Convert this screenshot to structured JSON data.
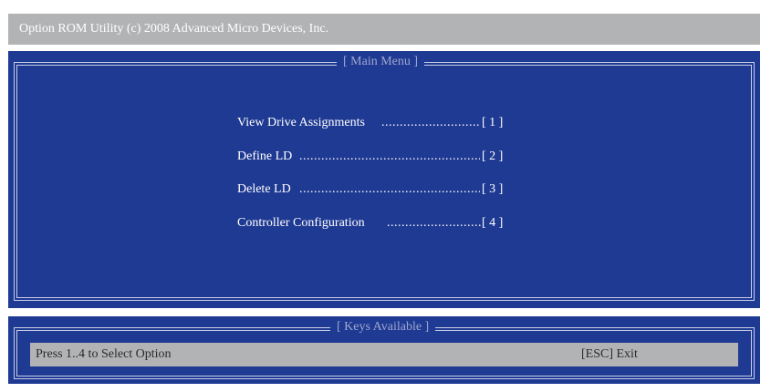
{
  "title_bar": {
    "text": "Option ROM Utility (c) 2008 Advanced Micro Devices, Inc."
  },
  "main_menu": {
    "title": "[ Main Menu ]",
    "items": [
      {
        "label": "View Drive Assignments",
        "key": "[ 1 ]"
      },
      {
        "label": "Define LD",
        "key": "[ 2 ]"
      },
      {
        "label": "Delete LD",
        "key": "[ 3 ]"
      },
      {
        "label": "Controller Configuration",
        "key": "[ 4 ]"
      }
    ]
  },
  "keys_available": {
    "title": "[ Keys Available ]",
    "left_hint": "Press 1..4 to Select Option",
    "right_hint": "[ESC] Exit"
  },
  "colors": {
    "panel_background": "#1f3a93",
    "title_bar": "#b2b3b5",
    "border": "#c9cde6"
  }
}
